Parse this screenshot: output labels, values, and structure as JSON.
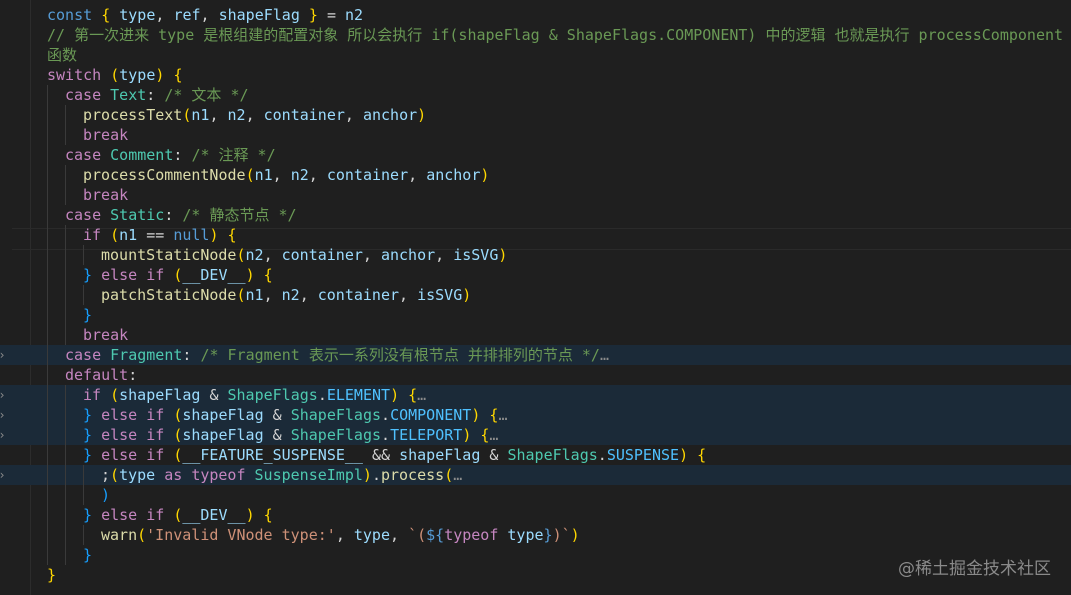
{
  "editor": {
    "language": "typescript",
    "lines": [
      "const { type, ref, shapeFlag } = n2",
      "// 第一次进来 type 是根组建的配置对象 所以会执行 if(shapeFlag & ShapeFlags.COMPONENT) 中的逻辑 也就是执行 processComponent",
      "函数",
      "switch (type) {",
      "case Text: /* 文本 */",
      "processText(n1, n2, container, anchor)",
      "break",
      "case Comment: /* 注释 */",
      "processCommentNode(n1, n2, container, anchor)",
      "break",
      "case Static: /* 静态节点 */",
      "if (n1 == null) {",
      "mountStaticNode(n2, container, anchor, isSVG)",
      "} else if (__DEV__) {",
      "patchStaticNode(n1, n2, container, isSVG)",
      "}",
      "break",
      "case Fragment: /* Fragment 表示一系列没有根节点 并排排列的节点 */…",
      "default:",
      "if (shapeFlag & ShapeFlags.ELEMENT) {…",
      "} else if (shapeFlag & ShapeFlags.COMPONENT) {…",
      "} else if (shapeFlag & ShapeFlags.TELEPORT) {…",
      "} else if (__FEATURE_SUSPENSE__ && shapeFlag & ShapeFlags.SUSPENSE) {",
      ";(type as typeof SuspenseImpl).process(…",
      ")",
      "} else if (__DEV__) {",
      "warn('Invalid VNode type:', type, `(${typeof type})`)",
      "}",
      "}"
    ],
    "folded_lines": [
      18,
      20,
      21,
      22,
      24
    ]
  },
  "watermark": "@稀土掘金技术社区",
  "colors": {
    "background": "#1f1f1f",
    "keyword": "#c586c0",
    "declaration": "#569cd6",
    "variable": "#9cdcfe",
    "type": "#4ec9b0",
    "function": "#dcdcaa",
    "string": "#ce9178",
    "comment": "#6a9955",
    "highlight_row": "#1b2a38"
  }
}
